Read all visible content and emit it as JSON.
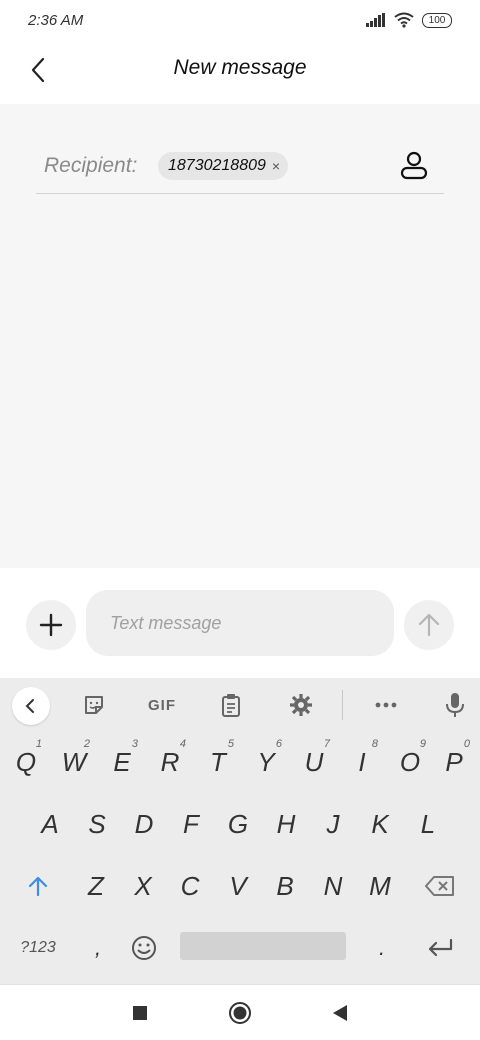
{
  "status_bar": {
    "time": "2:36 AM",
    "battery": "100"
  },
  "header": {
    "title": "New message",
    "back_icon": "back-arrow-icon"
  },
  "recipient": {
    "label": "Recipient:",
    "chip_number": "18730218809",
    "chip_remove": "×",
    "contact_icon": "person-icon"
  },
  "compose": {
    "placeholder": "Text message",
    "add_icon": "plus-icon",
    "send_icon": "send-arrow-icon"
  },
  "keyboard": {
    "toolbar": {
      "back_icon": "chevron-left-icon",
      "sticker_icon": "sticker-icon",
      "gif_label": "GIF",
      "clipboard_icon": "clipboard-icon",
      "settings_icon": "gear-icon",
      "more_icon": "more-dots-icon",
      "mic_icon": "mic-icon"
    },
    "row1": [
      {
        "l": "Q",
        "h": "1"
      },
      {
        "l": "W",
        "h": "2"
      },
      {
        "l": "E",
        "h": "3"
      },
      {
        "l": "R",
        "h": "4"
      },
      {
        "l": "T",
        "h": "5"
      },
      {
        "l": "Y",
        "h": "6"
      },
      {
        "l": "U",
        "h": "7"
      },
      {
        "l": "I",
        "h": "8"
      },
      {
        "l": "O",
        "h": "9"
      },
      {
        "l": "P",
        "h": "0"
      }
    ],
    "row2": [
      "A",
      "S",
      "D",
      "F",
      "G",
      "H",
      "J",
      "K",
      "L"
    ],
    "row3": [
      "Z",
      "X",
      "C",
      "V",
      "B",
      "N",
      "M"
    ],
    "row4": {
      "symbols": "?123",
      "comma": ",",
      "period": ".",
      "emoji_icon": "emoji-icon",
      "enter_icon": "enter-icon"
    },
    "shift_icon": "shift-icon",
    "backspace_icon": "backspace-icon",
    "accent_color": "#3a8ee6"
  },
  "navbar": {
    "recents_icon": "recents-square-icon",
    "home_icon": "home-circle-icon",
    "back_icon": "nav-back-triangle-icon"
  }
}
